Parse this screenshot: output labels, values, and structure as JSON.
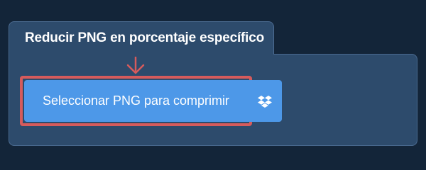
{
  "panel": {
    "title": "Reducir PNG en porcentaje específico"
  },
  "upload": {
    "select_label": "Seleccionar PNG para comprimir",
    "dropbox_icon": "dropbox-icon",
    "hint_icon": "arrow-down-icon"
  },
  "colors": {
    "background": "#132539",
    "panel": "#2d4b6c",
    "button": "#4d98e8",
    "highlight": "#d65b5c"
  }
}
